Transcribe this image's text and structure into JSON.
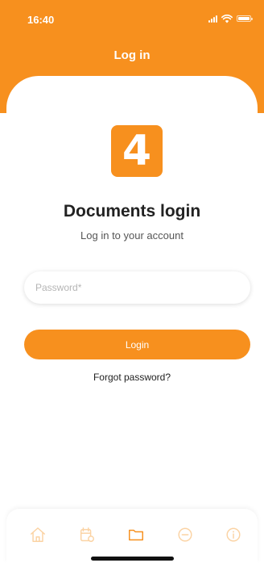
{
  "status_bar": {
    "time": "16:40"
  },
  "header": {
    "title": "Log in"
  },
  "logo": {
    "glyph": "4"
  },
  "login": {
    "title": "Documents login",
    "subtitle": "Log in to your account",
    "password_placeholder": "Password*",
    "password_value": "",
    "button_label": "Login",
    "forgot_label": "Forgot password?"
  },
  "tabbar": {
    "items": [
      {
        "icon": "home-icon",
        "active": false
      },
      {
        "icon": "calendar-icon",
        "active": false
      },
      {
        "icon": "folder-icon",
        "active": true
      },
      {
        "icon": "chat-icon",
        "active": false
      },
      {
        "icon": "info-icon",
        "active": false
      }
    ]
  },
  "colors": {
    "brand": "#F7901E",
    "brand_light": "#FBD3A4",
    "text_dark": "#222222",
    "text_muted": "#555555"
  }
}
